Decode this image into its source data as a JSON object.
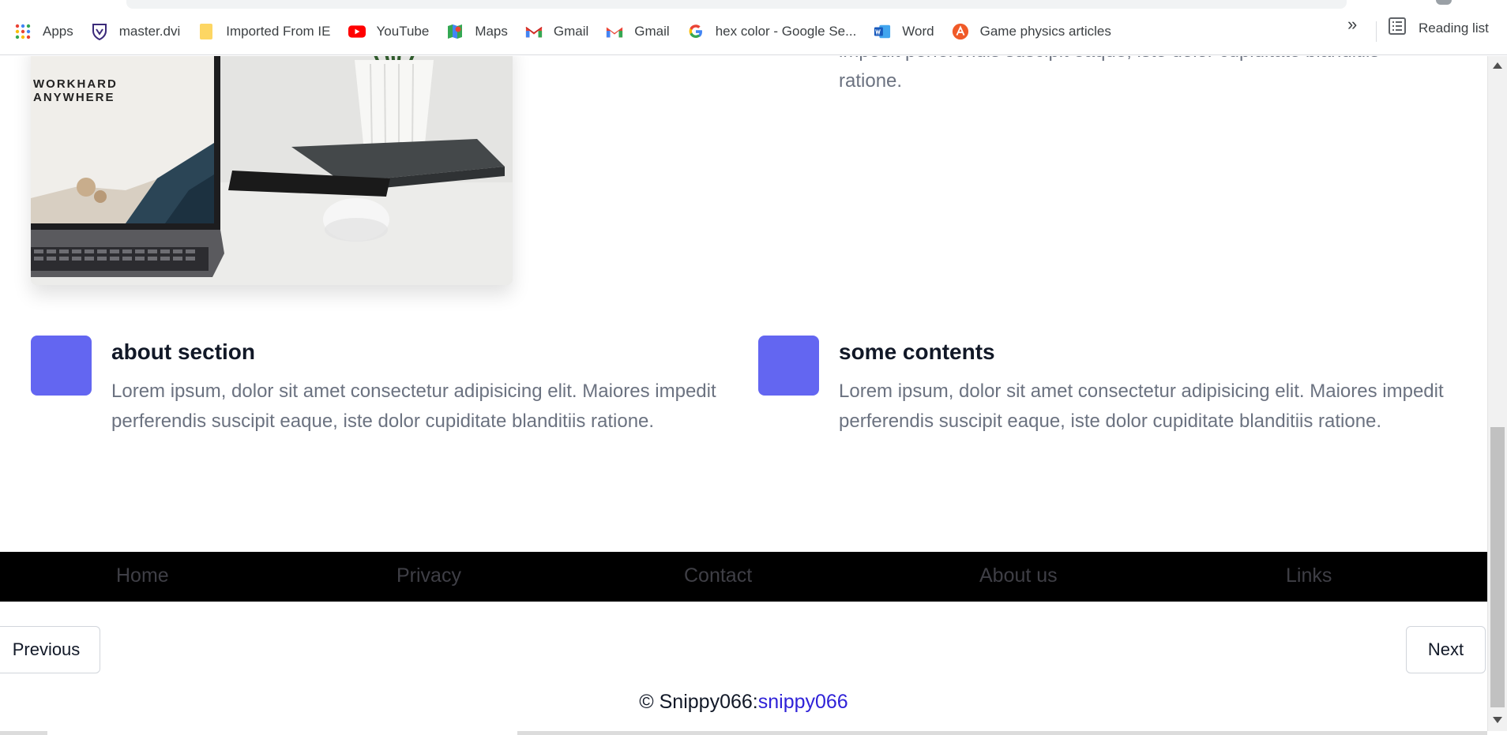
{
  "bookmarks": {
    "items": [
      {
        "label": "Apps",
        "icon": "apps-grid-icon"
      },
      {
        "label": "master.dvi",
        "icon": "crest-icon"
      },
      {
        "label": "Imported From IE",
        "icon": "folder-icon"
      },
      {
        "label": "YouTube",
        "icon": "youtube-icon"
      },
      {
        "label": "Maps",
        "icon": "maps-icon"
      },
      {
        "label": "Gmail",
        "icon": "gmail-icon"
      },
      {
        "label": "Gmail",
        "icon": "gmail-icon"
      },
      {
        "label": "hex color - Google Se...",
        "icon": "google-icon"
      },
      {
        "label": "Word",
        "icon": "word-icon"
      },
      {
        "label": "Game physics articles",
        "icon": "article-icon"
      }
    ],
    "more": "»",
    "reading_list": "Reading list"
  },
  "hero_image": {
    "screen_text_1": "WORKHARD",
    "screen_text_2": "ANYWHERE"
  },
  "top_feature": {
    "partial_text": "impedit perferendis suscipit eaque, iste dolor cupiditate blanditiis",
    "text_end": "ratione."
  },
  "features": [
    {
      "title": "about section",
      "body": "Lorem ipsum, dolor sit amet consectetur adipisicing elit. Maiores impedit perferendis suscipit eaque, iste dolor cupiditate blanditiis ratione."
    },
    {
      "title": "some contents",
      "body": "Lorem ipsum, dolor sit amet consectetur adipisicing elit. Maiores impedit perferendis suscipit eaque, iste dolor cupiditate blanditiis ratione."
    }
  ],
  "footer_nav": {
    "home": "Home",
    "privacy": "Privacy",
    "contact": "Contact",
    "about": "About us",
    "links": "Links"
  },
  "pagination": {
    "previous": "Previous",
    "next": "Next"
  },
  "copyright": {
    "prefix": "© Snippy066:",
    "link": "snippy066"
  },
  "colors": {
    "accent_square": "#6366f1",
    "footer_bg": "#000000",
    "link": "#2f22d8"
  }
}
